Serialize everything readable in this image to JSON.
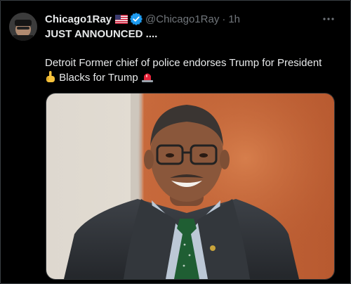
{
  "tweet": {
    "display_name": "Chicago1Ray",
    "handle": "@Chicago1Ray",
    "separator": "·",
    "time": "1h",
    "more_label": "···",
    "headline": "JUST ANNOUNCED ....",
    "body_line1": "Detroit Former chief of police endorses Trump for President",
    "body_line2": "Blacks for Trump",
    "flag_emoji": "us-flag-icon",
    "pointing_emoji": "point-down-icon",
    "siren_emoji": "rotating-light-icon"
  },
  "colors": {
    "background": "#000000",
    "text": "#e7e9ea",
    "muted": "#71767b",
    "verified": "#1d9bf0"
  }
}
